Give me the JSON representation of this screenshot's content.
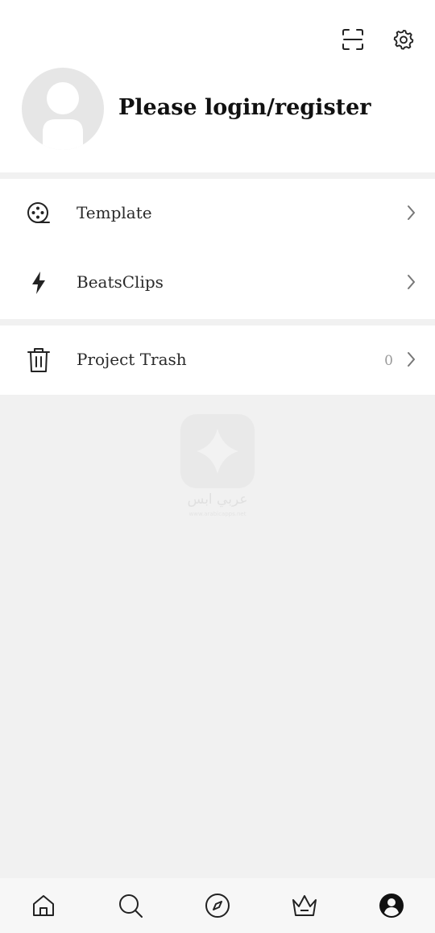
{
  "header": {
    "scan_icon": "scan-icon",
    "settings_icon": "gear-icon",
    "login_label": "Please login/register"
  },
  "menu": {
    "group1": [
      {
        "label": "Template",
        "icon": "film-reel-icon"
      },
      {
        "label": "BeatsClips",
        "icon": "lightning-icon"
      }
    ],
    "group2": [
      {
        "label": "Project Trash",
        "icon": "trash-icon",
        "count": "0"
      }
    ]
  },
  "watermark": {
    "text": "عربي ابس",
    "subtext": "www.arabicapps.net"
  },
  "bottom_nav": {
    "items": [
      "home-icon",
      "search-icon",
      "compass-icon",
      "crown-icon",
      "profile-icon"
    ],
    "active": "profile-icon"
  },
  "colors": {
    "background": "#f1f1f1",
    "surface": "#ffffff",
    "text": "#222222",
    "muted": "#9a9a9a",
    "avatar": "#e6e6e6"
  }
}
